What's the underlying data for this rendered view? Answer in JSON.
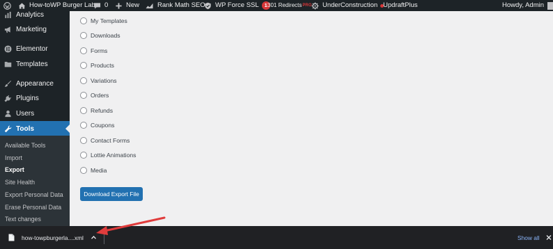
{
  "adminbar": {
    "site_name": "How-toWP Burger Lab",
    "comments_count": "0",
    "new_label": "New",
    "rankmath_label": "Rank Math SEO",
    "wpforce_label": "WP Force SSL",
    "wpforce_badge": "1",
    "redirects_label": "301 Redirects",
    "redirects_pro": "PRO",
    "underconstruction_label": "UnderConstruction",
    "updraft_label": "UpdraftPlus",
    "howdy_label": "Howdy, Admin"
  },
  "sidebar": {
    "items": [
      {
        "label": "Analytics",
        "icon": "analytics-icon"
      },
      {
        "label": "Marketing",
        "icon": "megaphone-icon"
      },
      {
        "label": "Elementor",
        "icon": "elementor-icon"
      },
      {
        "label": "Templates",
        "icon": "folder-icon"
      },
      {
        "label": "Appearance",
        "icon": "paintbrush-icon"
      },
      {
        "label": "Plugins",
        "icon": "plug-icon"
      },
      {
        "label": "Users",
        "icon": "users-icon"
      },
      {
        "label": "Tools",
        "icon": "wrench-icon"
      }
    ],
    "submenu": [
      "Available Tools",
      "Import",
      "Export",
      "Site Health",
      "Export Personal Data",
      "Erase Personal Data",
      "Text changes"
    ]
  },
  "export": {
    "options": [
      "My Templates",
      "Downloads",
      "Forms",
      "Products",
      "Variations",
      "Orders",
      "Refunds",
      "Coupons",
      "Contact Forms",
      "Lottie Animations",
      "Media"
    ],
    "button_label": "Download Export File"
  },
  "download_shelf": {
    "filename": "how-towpburgerla....xml",
    "show_all_label": "Show all"
  },
  "colors": {
    "admin_dark": "#1d2327",
    "submenu_bg": "#2c3338",
    "accent_blue": "#2271b1",
    "badge_red": "#d63638",
    "annotation_red": "#e03c3c",
    "shelf_bg": "#202124",
    "show_all_link": "#8ab4f8"
  }
}
